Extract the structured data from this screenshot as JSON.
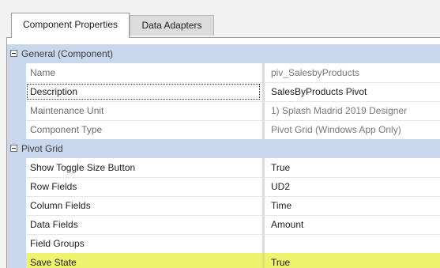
{
  "tabs": [
    {
      "label": "Component Properties",
      "active": true
    },
    {
      "label": "Data Adapters",
      "active": false
    }
  ],
  "colors": {
    "category_band": "#c9d7ec",
    "highlight_row": "#edf26f"
  },
  "groups": [
    {
      "label": "General (Component)",
      "expanded": true,
      "rows": [
        {
          "name": "Name",
          "value": "piv_SalesbyProducts",
          "readonly": true
        },
        {
          "name": "Description",
          "value": "SalesByProducts Pivot",
          "readonly": false,
          "focused": true
        },
        {
          "name": "Maintenance Unit",
          "value": "1) Splash Madrid 2019 Designer",
          "readonly": true
        },
        {
          "name": "Component Type",
          "value": "Pivot Grid (Windows App Only)",
          "readonly": true
        }
      ]
    },
    {
      "label": "Pivot Grid",
      "expanded": true,
      "rows": [
        {
          "name": "Show Toggle Size Button",
          "value": "True",
          "readonly": false
        },
        {
          "name": "Row Fields",
          "value": "UD2",
          "readonly": false
        },
        {
          "name": "Column Fields",
          "value": "Time",
          "readonly": false
        },
        {
          "name": "Data Fields",
          "value": "Amount",
          "readonly": false
        },
        {
          "name": "Field Groups",
          "value": "",
          "readonly": false
        },
        {
          "name": "Save State",
          "value": "True",
          "readonly": false,
          "highlighted": true
        }
      ]
    }
  ]
}
